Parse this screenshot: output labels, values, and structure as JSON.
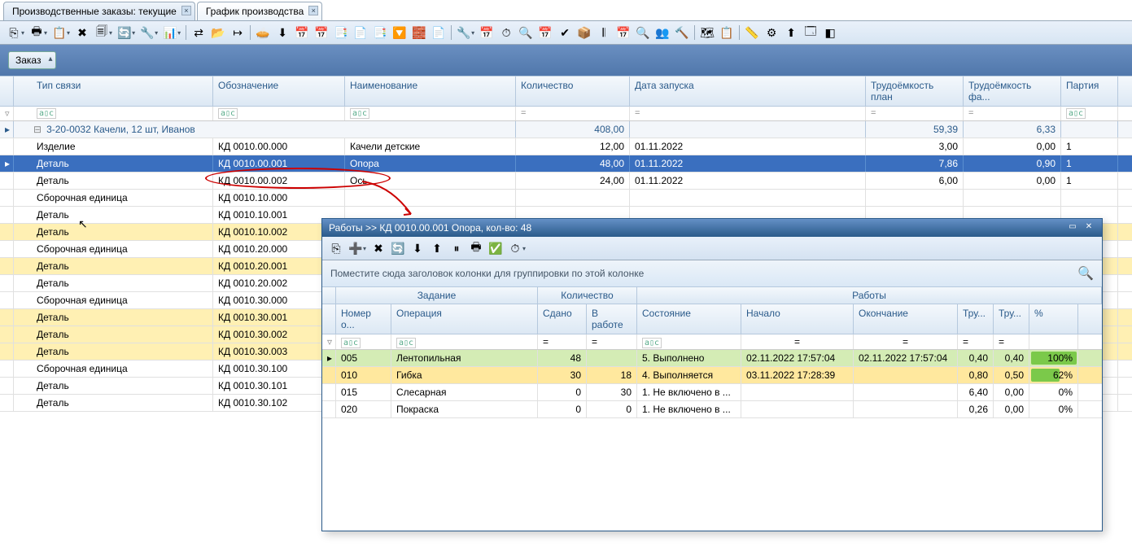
{
  "tabs": [
    {
      "label": "Производственные заказы: текущие",
      "active": false
    },
    {
      "label": "График производства",
      "active": true
    }
  ],
  "group_chip": "Заказ",
  "columns": {
    "type": "Тип связи",
    "obozn": "Обозначение",
    "naim": "Наименование",
    "qty": "Количество",
    "date": "Дата запуска",
    "plan": "Трудоёмкость план",
    "fact": "Трудоёмкость фа...",
    "party": "Партия"
  },
  "filter_symbols": {
    "text": "a▯c",
    "eq": "="
  },
  "group_row": {
    "label": "3-20-0032 Качели, 12 шт, Иванов",
    "qty": "408,00",
    "plan": "59,39",
    "fact": "6,33"
  },
  "rows": [
    {
      "type": "Изделие",
      "obozn": "КД 0010.00.000",
      "naim": "Качели детские",
      "qty": "12,00",
      "date": "01.11.2022",
      "plan": "3,00",
      "fact": "0,00",
      "party": "1",
      "hl": ""
    },
    {
      "type": "Деталь",
      "obozn": "КД 0010.00.001",
      "naim": "Опора",
      "qty": "48,00",
      "date": "01.11.2022",
      "plan": "7,86",
      "fact": "0,90",
      "party": "1",
      "hl": "selected"
    },
    {
      "type": "Деталь",
      "obozn": "КД 0010.00.002",
      "naim": "Ось",
      "qty": "24,00",
      "date": "01.11.2022",
      "plan": "6,00",
      "fact": "0,00",
      "party": "1",
      "hl": ""
    },
    {
      "type": "Сборочная единица",
      "obozn": "КД 0010.10.000",
      "naim": "",
      "qty": "",
      "date": "",
      "plan": "",
      "fact": "",
      "party": "",
      "hl": ""
    },
    {
      "type": "Деталь",
      "obozn": "КД 0010.10.001",
      "naim": "",
      "qty": "",
      "date": "",
      "plan": "",
      "fact": "",
      "party": "",
      "hl": ""
    },
    {
      "type": "Деталь",
      "obozn": "КД 0010.10.002",
      "naim": "",
      "qty": "",
      "date": "",
      "plan": "",
      "fact": "",
      "party": "",
      "hl": "yellow"
    },
    {
      "type": "Сборочная единица",
      "obozn": "КД 0010.20.000",
      "naim": "",
      "qty": "",
      "date": "",
      "plan": "",
      "fact": "",
      "party": "",
      "hl": ""
    },
    {
      "type": "Деталь",
      "obozn": "КД 0010.20.001",
      "naim": "",
      "qty": "",
      "date": "",
      "plan": "",
      "fact": "",
      "party": "",
      "hl": "yellow"
    },
    {
      "type": "Деталь",
      "obozn": "КД 0010.20.002",
      "naim": "",
      "qty": "",
      "date": "",
      "plan": "",
      "fact": "",
      "party": "",
      "hl": ""
    },
    {
      "type": "Сборочная единица",
      "obozn": "КД 0010.30.000",
      "naim": "",
      "qty": "",
      "date": "",
      "plan": "",
      "fact": "",
      "party": "",
      "hl": ""
    },
    {
      "type": "Деталь",
      "obozn": "КД 0010.30.001",
      "naim": "",
      "qty": "",
      "date": "",
      "plan": "",
      "fact": "",
      "party": "",
      "hl": "yellow"
    },
    {
      "type": "Деталь",
      "obozn": "КД 0010.30.002",
      "naim": "",
      "qty": "",
      "date": "",
      "plan": "",
      "fact": "",
      "party": "",
      "hl": "yellow"
    },
    {
      "type": "Деталь",
      "obozn": "КД 0010.30.003",
      "naim": "",
      "qty": "",
      "date": "",
      "plan": "",
      "fact": "",
      "party": "",
      "hl": "yellow"
    },
    {
      "type": "Сборочная единица",
      "obozn": "КД 0010.30.100",
      "naim": "",
      "qty": "",
      "date": "",
      "plan": "",
      "fact": "",
      "party": "",
      "hl": ""
    },
    {
      "type": "Деталь",
      "obozn": "КД 0010.30.101",
      "naim": "",
      "qty": "",
      "date": "",
      "plan": "",
      "fact": "",
      "party": "",
      "hl": ""
    },
    {
      "type": "Деталь",
      "obozn": "КД 0010.30.102",
      "naim": "",
      "qty": "",
      "date": "",
      "plan": "",
      "fact": "",
      "party": "",
      "hl": ""
    }
  ],
  "popup": {
    "title": "Работы >> КД 0010.00.001 Опора, кол-во: 48",
    "group_hint": "Поместите сюда заголовок колонки для группировки по этой колонке",
    "bands": {
      "task": "Задание",
      "qty": "Количество",
      "works": "Работы"
    },
    "cols": {
      "no": "Номер о...",
      "op": "Операция",
      "given": "Сдано",
      "work": "В работе",
      "state": "Состояние",
      "start": "Начало",
      "end": "Окончание",
      "tr1": "Тру...",
      "tr2": "Тру...",
      "pct": "%"
    },
    "rows": [
      {
        "no": "005",
        "op": "Лентопильная",
        "given": "48",
        "work": "",
        "state": "5. Выполнено",
        "start": "02.11.2022 17:57:04",
        "end": "02.11.2022 17:57:04",
        "tr1": "0,40",
        "tr2": "0,40",
        "pct": "100%",
        "hl": "green",
        "pctw": 100
      },
      {
        "no": "010",
        "op": "Гибка",
        "given": "30",
        "work": "18",
        "state": "4. Выполняется",
        "start": "03.11.2022 17:28:39",
        "end": "",
        "tr1": "0,80",
        "tr2": "0,50",
        "pct": "62%",
        "hl": "yellow",
        "pctw": 62
      },
      {
        "no": "015",
        "op": "Слесарная",
        "given": "0",
        "work": "30",
        "state": "1. Не включено в ...",
        "start": "",
        "end": "",
        "tr1": "6,40",
        "tr2": "0,00",
        "pct": "0%",
        "hl": "",
        "pctw": 0
      },
      {
        "no": "020",
        "op": "Покраска",
        "given": "0",
        "work": "0",
        "state": "1. Не включено в ...",
        "start": "",
        "end": "",
        "tr1": "0,26",
        "tr2": "0,00",
        "pct": "0%",
        "hl": "",
        "pctw": 0
      }
    ]
  },
  "toolbar_icons": [
    "⎘",
    "▾",
    "🖶",
    "▾",
    "📋",
    "▾",
    "✖",
    "🗐",
    "▾",
    "🔄",
    "▾",
    "🔧",
    "▾",
    "📊",
    "▾",
    "",
    "⇄",
    "📂",
    "↦",
    "",
    "🥧",
    "⬇",
    "📅",
    "📅",
    "📑",
    "📄",
    "📑",
    "🔽",
    "🧱",
    "📄",
    "",
    "🔧",
    "▾",
    "📅",
    "⏱",
    "🔍",
    "📅",
    "✔",
    "📦",
    "𝄃",
    "📅",
    "🔍",
    "👥",
    "🔨",
    "",
    "🗺",
    "📋",
    "",
    "📏",
    "⚙",
    "⬆",
    "🗔",
    "◧"
  ],
  "popup_toolbar_icons": [
    "⎘",
    "➕",
    "▾",
    "✖",
    "🔄",
    "⬇",
    "⬆",
    "⏸",
    "🖶",
    "✅",
    "⏱",
    "▾"
  ]
}
